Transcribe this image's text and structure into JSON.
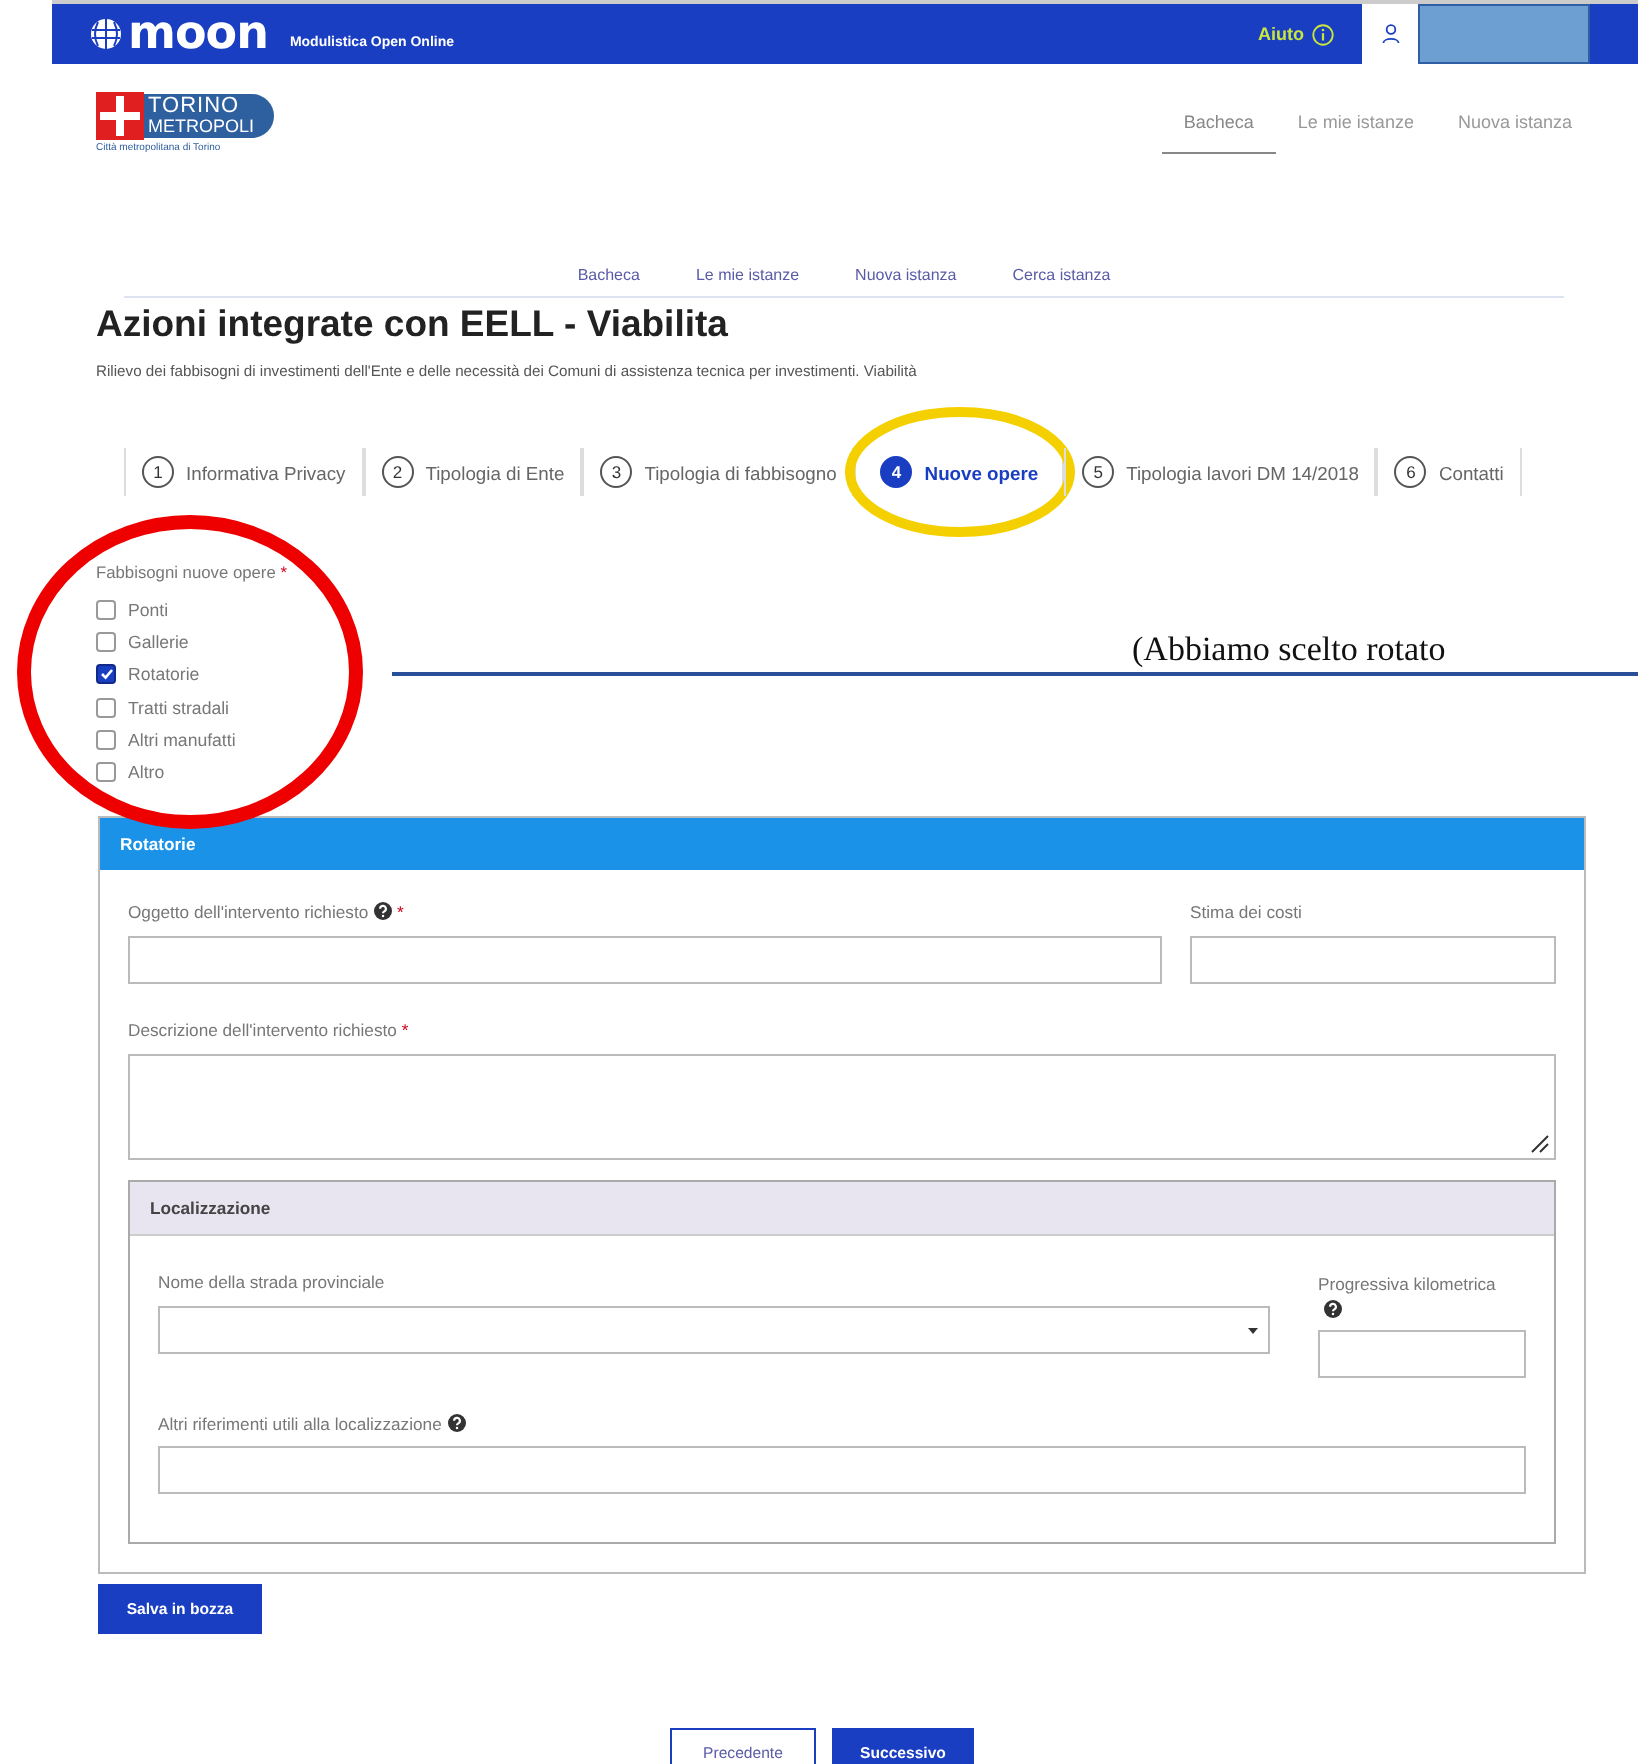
{
  "header": {
    "logo": "moon",
    "tagline": "Modulistica Open Online",
    "help": "Aiuto"
  },
  "site_logo": {
    "line1": "TORINO",
    "line2": "METROPOLI",
    "caption": "Città metropolitana di Torino"
  },
  "top_nav": [
    {
      "label": "Bacheca",
      "selected": true
    },
    {
      "label": "Le mie istanze",
      "selected": false
    },
    {
      "label": "Nuova istanza",
      "selected": false
    }
  ],
  "sub_nav": [
    "Bacheca",
    "Le mie istanze",
    "Nuova istanza",
    "Cerca istanza"
  ],
  "title": "Azioni integrate con EELL - Viabilita",
  "subtitle": "Rilievo dei fabbisogni di investimenti dell'Ente e delle necessità dei Comuni di assistenza tecnica per investimenti. Viabilità",
  "steps": [
    {
      "number": "1",
      "label": "Informativa Privacy",
      "selected": false
    },
    {
      "number": "2",
      "label": "Tipologia di Ente",
      "selected": false
    },
    {
      "number": "3",
      "label": "Tipologia di fabbisogno",
      "selected": false
    },
    {
      "number": "4",
      "label": "Nuove opere",
      "selected": true
    },
    {
      "number": "5",
      "label": "Tipologia lavori DM 14/2018",
      "selected": false
    },
    {
      "number": "6",
      "label": "Contatti",
      "selected": false
    }
  ],
  "needs": {
    "label": "Fabbisogni nuove opere",
    "required_mark": "*",
    "options": [
      {
        "label": "Ponti",
        "checked": false
      },
      {
        "label": "Gallerie",
        "checked": false
      },
      {
        "label": "Rotatorie",
        "checked": true
      },
      {
        "label": "Tratti stradali",
        "checked": false
      },
      {
        "label": "Altri manufatti",
        "checked": false
      },
      {
        "label": "Altro",
        "checked": false
      }
    ]
  },
  "panel": {
    "title": "Rotatorie",
    "subject": {
      "label": "Oggetto dell'intervento richiesto",
      "help": true,
      "required_mark": "*"
    },
    "cost": {
      "label": "Stima dei costi",
      "help": false
    },
    "description": {
      "label": "Descrizione dell'intervento richiesto",
      "help": false,
      "required_mark": "*"
    },
    "location": {
      "title": "Localizzazione",
      "road": {
        "label": "Nome della strada provinciale",
        "help": false
      },
      "km": {
        "label": "Progressiva kilometrica",
        "help": true
      },
      "other": {
        "label": "Altri riferimenti utili alla localizzazione",
        "help": true
      }
    }
  },
  "draft_button": "Salva in bozza",
  "prev_button": "Precedente",
  "next_button": "Successivo",
  "annotation": {
    "text": "(Abbiamo scelto rotato"
  }
}
